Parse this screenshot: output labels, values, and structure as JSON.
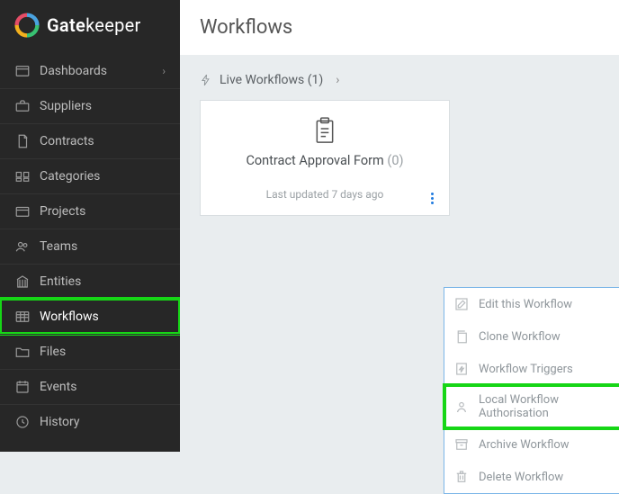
{
  "brand": {
    "name_bold": "Gate",
    "name_light": "keeper"
  },
  "sidebar": {
    "items": [
      {
        "label": "Dashboards",
        "has_chevron": true
      },
      {
        "label": "Suppliers"
      },
      {
        "label": "Contracts"
      },
      {
        "label": "Categories"
      },
      {
        "label": "Projects"
      },
      {
        "label": "Teams"
      },
      {
        "label": "Entities"
      },
      {
        "label": "Workflows",
        "active": true
      },
      {
        "label": "Files"
      },
      {
        "label": "Events"
      },
      {
        "label": "History"
      }
    ]
  },
  "page": {
    "title": "Workflows"
  },
  "section": {
    "label": "Live Workflows",
    "count": "(1)"
  },
  "card": {
    "title": "Contract Approval Form",
    "count": "(0)",
    "subtitle": "Last updated 7 days ago"
  },
  "menu": {
    "items": [
      {
        "label": "Edit this Workflow"
      },
      {
        "label": "Clone Workflow"
      },
      {
        "label": "Workflow Triggers"
      },
      {
        "label": "Local Workflow Authorisation",
        "highlight": true
      },
      {
        "label": "Archive Workflow"
      },
      {
        "label": "Delete Workflow"
      }
    ]
  }
}
